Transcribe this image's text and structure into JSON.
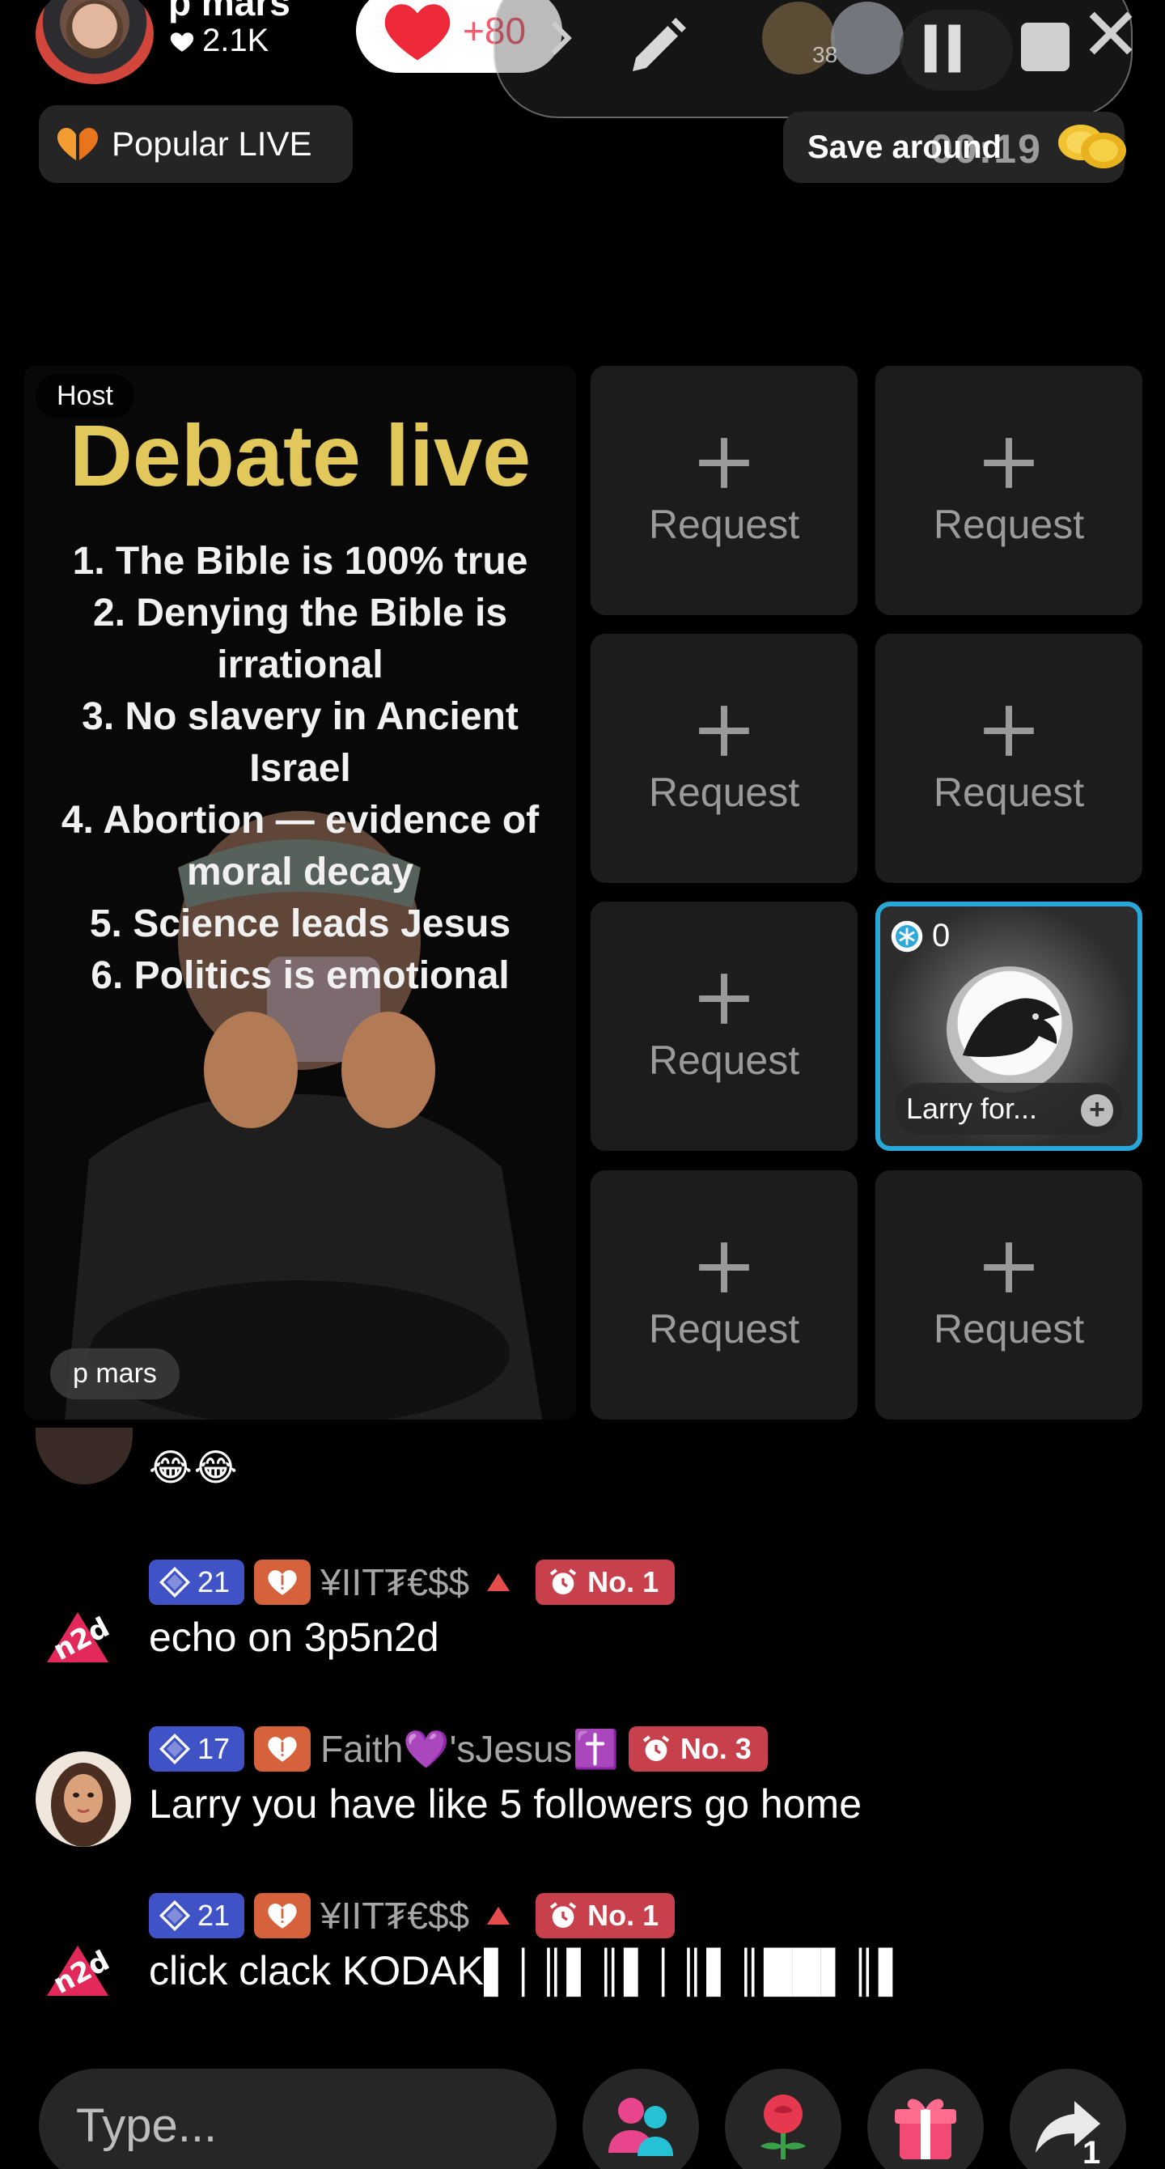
{
  "header": {
    "host_name": "p mars",
    "host_likes": "2.1K",
    "like_count": "+80",
    "viewer_count": "38",
    "timer": "00:19",
    "popular_live_label": "Popular LIVE",
    "save_label": "Save around"
  },
  "host_tile": {
    "badge": "Host",
    "title": "Debate live",
    "points": [
      "1. The Bible is 100% true",
      "2. Denying the Bible is",
      "irrational",
      "3. No slavery in Ancient",
      "Israel",
      "4. Abortion — evidence of",
      "moral decay",
      "5. Science leads Jesus",
      "6. Politics is emotional"
    ],
    "name_tag": "p mars"
  },
  "request_label": "Request",
  "guest": {
    "score": "0",
    "name": "Larry for..."
  },
  "chat": {
    "partial_emoji": "😂😂",
    "messages": [
      {
        "level": "21",
        "user": "¥IIT₮€$$",
        "rank": "No. 1",
        "text": "echo on 3p5n2d",
        "avatar": "n2d"
      },
      {
        "level": "17",
        "user": "Faith💜'sJesus✝️",
        "rank": "No. 3",
        "text": "Larry you have like 5 followers go home",
        "avatar": "faith"
      },
      {
        "level": "21",
        "user": "¥IIT₮€$$",
        "rank": "No. 1",
        "text": "click clack KODAK▌│║▌║▌│║▌║██▌║▌",
        "avatar": "n2d"
      }
    ]
  },
  "bottom": {
    "type_placeholder": "Type...",
    "share_count": "1"
  },
  "colors": {
    "accent_blue": "#28a8d8",
    "level_badge": "#3f52c6",
    "rank_badge": "#c8404c",
    "fan_badge": "#d5623b",
    "debate_title": "#e2c85a"
  }
}
